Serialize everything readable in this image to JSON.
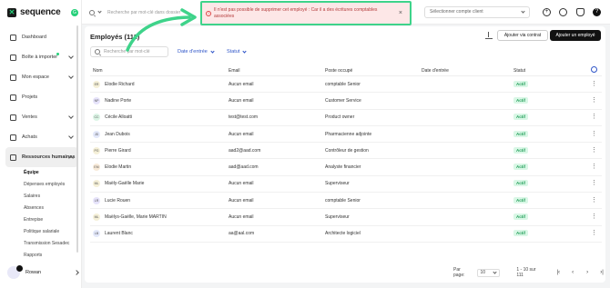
{
  "app": {
    "name": "sequence",
    "badge": "G"
  },
  "colors": {
    "accent": "#25d07a",
    "link": "#2f55c8",
    "toast_bg": "#fde7e7"
  },
  "nav": {
    "items": [
      {
        "label": "Dashboard",
        "icon": "dashboard-icon"
      },
      {
        "label": "Boîte à importer",
        "icon": "inbox-icon"
      },
      {
        "label": "Mon espace",
        "icon": "user-icon"
      },
      {
        "label": "Projets",
        "icon": "check-icon"
      },
      {
        "label": "Ventes",
        "icon": "lock-icon"
      },
      {
        "label": "Achats",
        "icon": "bag-icon"
      },
      {
        "label": "Ressources humaines",
        "icon": "people-icon"
      }
    ],
    "sub_items": [
      "Équipe",
      "Dépenses employés",
      "Salaires",
      "Absences",
      "Entrepise",
      "Politique salariale",
      "Transmission Sesadec",
      "Rapports"
    ]
  },
  "user": {
    "name": "Rowan"
  },
  "topbar": {
    "search_placeholder": "Recherche par mot-clé dans dossier",
    "company_placeholder": "Sélectionner compte client"
  },
  "toast": {
    "message": "Il n'est pas possible de supprimer cet employé : Car il a des écritures comptables associées",
    "close": "×",
    "icon": "!"
  },
  "main": {
    "title": "Employés (111)",
    "btn_contract": "Ajouter via contrat",
    "btn_add": "Ajouter un employé",
    "search_placeholder": "Recherche par mot-clé",
    "filter_date": "Date d'entrée",
    "filter_statut": "Statut",
    "columns": [
      "Nom",
      "Email",
      "Poste occupé",
      "Date d'entrée",
      "Statut"
    ],
    "rows": [
      {
        "ini": "ER",
        "color": "#f5f0d8",
        "name": "Elodie Richard",
        "email": "Aucun email",
        "poste": "comptable Senior",
        "date": "",
        "statut": "Actif"
      },
      {
        "ini": "NP",
        "color": "#e6e3fa",
        "name": "Nadine Porte",
        "email": "Aucun email",
        "poste": "Customer Service",
        "date": "",
        "statut": "Actif"
      },
      {
        "ini": "CC",
        "color": "#dcf5e6",
        "name": "Cécile Alloatti",
        "email": "test@test.com",
        "poste": "Product owner",
        "date": "",
        "statut": "Actif"
      },
      {
        "ini": "JD",
        "color": "#e3e8fa",
        "name": "Jean Dubois",
        "email": "Aucun email",
        "poste": "Pharmacienne adjointe",
        "date": "",
        "statut": "Actif"
      },
      {
        "ini": "PG",
        "color": "#f5f0d8",
        "name": "Pierre Girard",
        "email": "aad2@aad.com",
        "poste": "Contrôleur de gestion",
        "date": "",
        "statut": "Actif"
      },
      {
        "ini": "EM",
        "color": "#f8ead8",
        "name": "Elodie Martin",
        "email": "aad@aad.com",
        "poste": "Analyste financier",
        "date": "",
        "statut": "Actif"
      },
      {
        "ini": "ML",
        "color": "#f5f0d8",
        "name": "Maëly-Gaëlle Marie",
        "email": "Aucun email",
        "poste": "Superviseur",
        "date": "",
        "statut": "Actif"
      },
      {
        "ini": "LR",
        "color": "#e6e3fa",
        "name": "Lucie Rouen",
        "email": "Aucun email",
        "poste": "comptable Senior",
        "date": "",
        "statut": "Actif"
      },
      {
        "ini": "ML",
        "color": "#f5f0d8",
        "name": "Maëlys-Gaëlle, Marie MARTIN",
        "email": "Aucun email",
        "poste": "Superviseur",
        "date": "",
        "statut": "Actif"
      },
      {
        "ini": "LB",
        "color": "#e3e8fa",
        "name": "Laurent Blanc",
        "email": "aa@aal.com",
        "poste": "Architecte logiciel",
        "date": "",
        "statut": "Actif"
      }
    ]
  },
  "pager": {
    "label": "Par page:",
    "per_page": "10",
    "range": "1 - 10 sur 111"
  }
}
